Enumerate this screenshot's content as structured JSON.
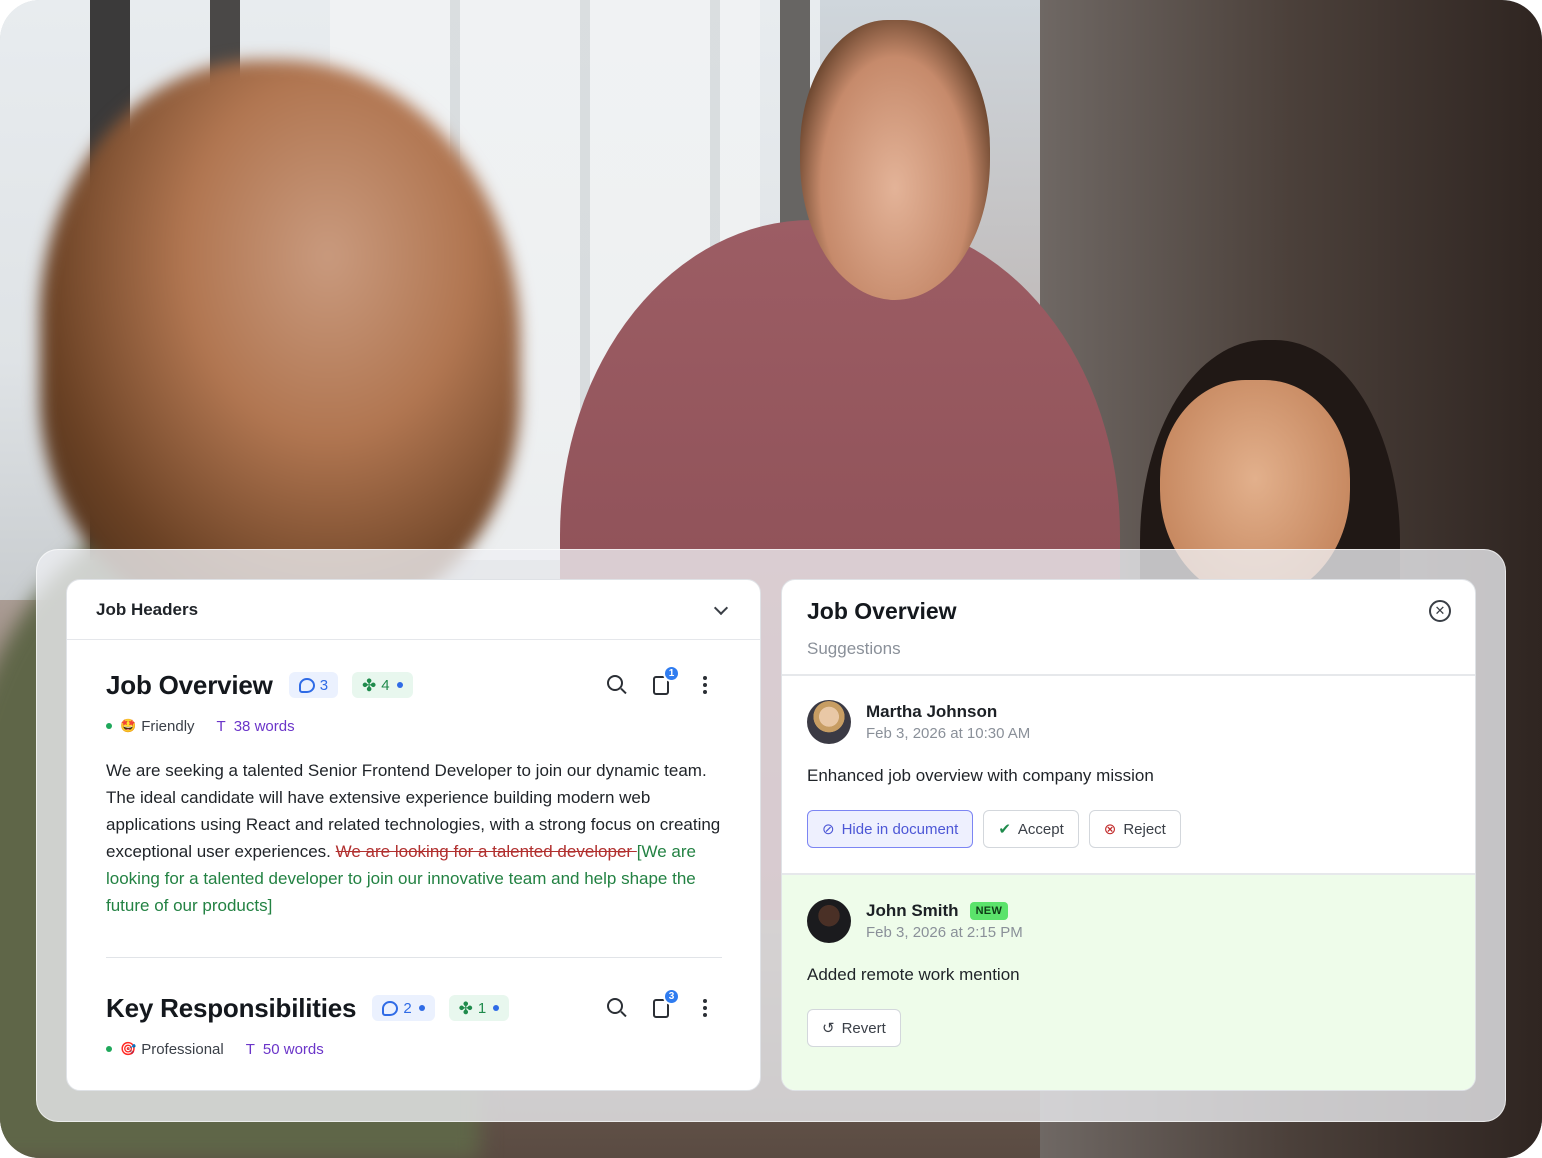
{
  "colors": {
    "accent_blue": "#2f6be6",
    "accent_green": "#1f8b4c",
    "deletion_red": "#b1302f",
    "insertion_green": "#238243",
    "word_count_purple": "#6b35c9",
    "new_badge": "#5be36b",
    "highlight_row": "#eefcea"
  },
  "left_panel": {
    "header_title": "Job Headers",
    "collapse_icon": "chevron-down-icon",
    "sections": [
      {
        "title": "Job Overview",
        "comments_count": "3",
        "suggestions_count": "4",
        "clipboard_badge": "1",
        "tone_emoji": "🤩",
        "tone": "Friendly",
        "word_count": "38 words",
        "body": "We are seeking a talented Senior Frontend Developer to join our dynamic team. The ideal candidate will have extensive experience building modern web applications using React and related technologies, with a strong focus on creating exceptional user experiences. ",
        "deleted_text": "We are looking for a talented developer ",
        "inserted_text": "[We are looking for a talented developer to join our innovative team and help shape the future of our products]"
      },
      {
        "title": "Key Responsibilities",
        "comments_count": "2",
        "suggestions_count": "1",
        "clipboard_badge": "3",
        "tone_emoji": "🎯",
        "tone": "Professional",
        "word_count": "50 words"
      }
    ]
  },
  "right_panel": {
    "title": "Job Overview",
    "subtitle": "Suggestions",
    "suggestions": [
      {
        "author": "Martha Johnson",
        "timestamp": "Feb 3, 2026 at 10:30 AM",
        "text": "Enhanced job overview with company mission",
        "actions": {
          "hide": "Hide in document",
          "accept": "Accept",
          "reject": "Reject"
        }
      },
      {
        "author": "John Smith",
        "badge": "NEW",
        "timestamp": "Feb 3, 2026 at 2:15 PM",
        "text": "Added remote work mention",
        "actions": {
          "revert": "Revert"
        }
      }
    ]
  }
}
